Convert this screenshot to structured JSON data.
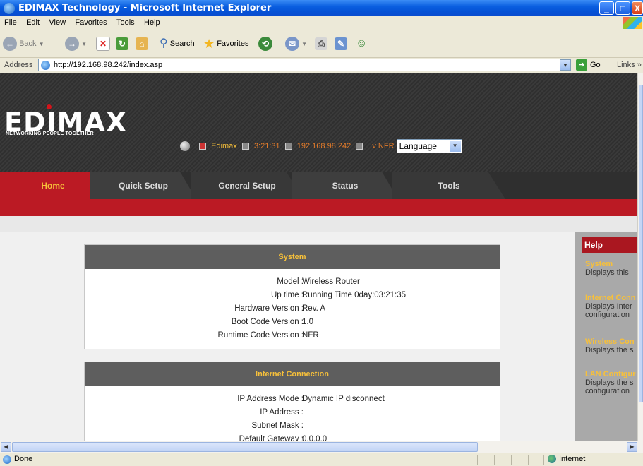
{
  "window": {
    "title": "EDIMAX Technology - Microsoft Internet Explorer",
    "controls": [
      "minimize",
      "maximize",
      "close"
    ]
  },
  "menu": [
    "File",
    "Edit",
    "View",
    "Favorites",
    "Tools",
    "Help"
  ],
  "toolbar": {
    "back": "Back",
    "search": "Search",
    "favorites": "Favorites"
  },
  "address": {
    "label": "Address",
    "url": "http://192.168.98.242/index.asp",
    "go": "Go",
    "links": "Links"
  },
  "router": {
    "logo": "EDIMAX",
    "tagline": "NETWORKING PEOPLE TOGETHER",
    "info": {
      "name": "Edimax",
      "time": "3:21:31",
      "ip": "192.168.98.242",
      "version": "v NFR",
      "language": "Language"
    },
    "tabs": [
      "Home",
      "Quick Setup",
      "General Setup",
      "Status",
      "Tools"
    ],
    "active_tab": "Home",
    "colors": {
      "accent_red": "#bb1a24",
      "heading_gold": "#f7c03a",
      "dark": "#2f2f2f"
    }
  },
  "system": {
    "title": "System",
    "rows": [
      {
        "label": "Model :",
        "value": "Wireless Router"
      },
      {
        "label": "Up time :",
        "value": "Running Time 0day:03:21:35"
      },
      {
        "label": "Hardware Version :",
        "value": "Rev. A"
      },
      {
        "label": "Boot Code Version :",
        "value": "1.0"
      },
      {
        "label": "Runtime Code Version :",
        "value": "NFR"
      }
    ]
  },
  "internet": {
    "title": "Internet Connection",
    "rows": [
      {
        "label": "IP Address Mode :",
        "value": "Dynamic IP disconnect"
      },
      {
        "label": "IP Address :",
        "value": ""
      },
      {
        "label": "Subnet Mask :",
        "value": ""
      },
      {
        "label": "Default Gateway :",
        "value": "0.0.0.0"
      }
    ]
  },
  "help": {
    "title": "Help",
    "items": [
      {
        "title": "System",
        "desc": [
          "Displays this"
        ]
      },
      {
        "title": "Internet Conn",
        "desc": [
          "Displays Inter",
          "configuration"
        ]
      },
      {
        "title": "Wireless Con",
        "desc": [
          "Displays the s"
        ]
      },
      {
        "title": "LAN Configur",
        "desc": [
          "Displays the s",
          "configuration"
        ]
      }
    ]
  },
  "status": {
    "text": "Done",
    "zone": "Internet"
  }
}
